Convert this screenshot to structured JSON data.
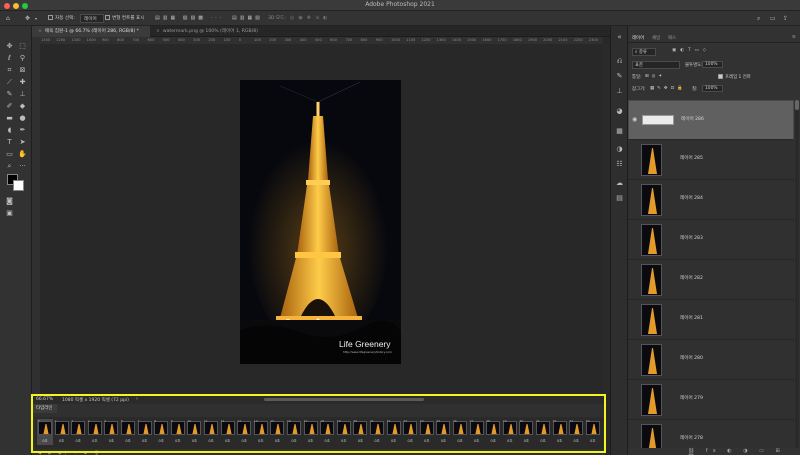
{
  "window": {
    "title": "Adobe Photoshop 2021"
  },
  "options_bar": {
    "auto_select_label": "자동 선택:",
    "auto_select_value": "레이어",
    "transform_label": "변형 컨트롤 표시",
    "mode_label": "3D 모드:"
  },
  "doc_tabs": [
    {
      "label": "애옥 집원-1 @ 66.7% (레이어 286, RGB/8) *",
      "active": true
    },
    {
      "label": "watermark.png @ 100% (레이어 1, RGB/8)",
      "active": false
    }
  ],
  "ruler_ticks": [
    "1300",
    "1200",
    "1100",
    "1000",
    "900",
    "800",
    "700",
    "600",
    "500",
    "400",
    "300",
    "200",
    "100",
    "0",
    "100",
    "200",
    "300",
    "400",
    "500",
    "600",
    "700",
    "800",
    "900",
    "1000",
    "1100",
    "1200",
    "1300",
    "1400",
    "1500",
    "1600",
    "1700",
    "1800",
    "1900",
    "2000",
    "2100",
    "2200",
    "2300"
  ],
  "canvas": {
    "watermark_title": "Life Greenery",
    "watermark_url": "http://www.lifegreenery.tistory.com"
  },
  "status": {
    "zoom": "66.67%",
    "info": "1080 픽셀 x 1920 픽셀 (72 ppi)"
  },
  "timeline": {
    "tab_label": "타임라인",
    "frames": [
      {
        "num": "1",
        "delay": "0초"
      },
      {
        "num": "2",
        "delay": "0초"
      },
      {
        "num": "3",
        "delay": "0초"
      },
      {
        "num": "4",
        "delay": "0초"
      },
      {
        "num": "5",
        "delay": "0초"
      },
      {
        "num": "6",
        "delay": "0초"
      },
      {
        "num": "7",
        "delay": "0초"
      },
      {
        "num": "8",
        "delay": "0초"
      },
      {
        "num": "9",
        "delay": "0초"
      },
      {
        "num": "10",
        "delay": "0초"
      },
      {
        "num": "11",
        "delay": "0초"
      },
      {
        "num": "12",
        "delay": "0초"
      },
      {
        "num": "13",
        "delay": "0초"
      },
      {
        "num": "14",
        "delay": "0초"
      },
      {
        "num": "15",
        "delay": "0초"
      },
      {
        "num": "16",
        "delay": "0초"
      },
      {
        "num": "17",
        "delay": "0초"
      },
      {
        "num": "18",
        "delay": "0초"
      },
      {
        "num": "19",
        "delay": "0초"
      },
      {
        "num": "20",
        "delay": "0초"
      },
      {
        "num": "21",
        "delay": "0초"
      },
      {
        "num": "22",
        "delay": "0초"
      },
      {
        "num": "23",
        "delay": "0초"
      },
      {
        "num": "24",
        "delay": "0초"
      },
      {
        "num": "25",
        "delay": "0초"
      },
      {
        "num": "26",
        "delay": "0초"
      },
      {
        "num": "27",
        "delay": "0초"
      },
      {
        "num": "28",
        "delay": "0초"
      },
      {
        "num": "29",
        "delay": "0초"
      },
      {
        "num": "30",
        "delay": "0초"
      },
      {
        "num": "31",
        "delay": "0초"
      },
      {
        "num": "32",
        "delay": "0초"
      },
      {
        "num": "33",
        "delay": "0초"
      },
      {
        "num": "34",
        "delay": "0초"
      }
    ]
  },
  "layers_panel": {
    "tabs": [
      "레이어",
      "채널",
      "패스"
    ],
    "kind_label": "종류",
    "blend_mode": "표준",
    "opacity_label": "불투명도:",
    "opacity_value": "100%",
    "unify_label": "통일:",
    "propagate_label": "프레임 1 전파",
    "lock_label": "잠그기:",
    "fill_label": "칠:",
    "fill_value": "100%",
    "layers": [
      {
        "name": "레이어 286",
        "selected": true
      },
      {
        "name": "레이어 285",
        "selected": false
      },
      {
        "name": "레이어 284",
        "selected": false
      },
      {
        "name": "레이어 283",
        "selected": false
      },
      {
        "name": "레이어 282",
        "selected": false
      },
      {
        "name": "레이어 281",
        "selected": false
      },
      {
        "name": "레이어 280",
        "selected": false
      },
      {
        "name": "레이어 279",
        "selected": false
      },
      {
        "name": "레이어 278",
        "selected": false
      }
    ]
  },
  "colors": {
    "highlight": "#f4f41e",
    "tower_glow": "#f2a623"
  }
}
